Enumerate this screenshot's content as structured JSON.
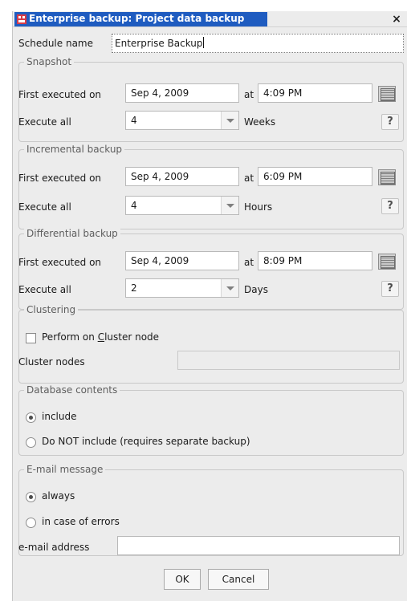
{
  "window": {
    "title": "Enterprise backup: Project data backup",
    "close_label": "×"
  },
  "schedule": {
    "label": "Schedule name",
    "value": "Enterprise Backup"
  },
  "snapshot": {
    "legend": "Snapshot",
    "first_label": "First executed on",
    "date": "Sep 4, 2009",
    "at_label": "at",
    "time": "4:09 PM",
    "execute_label": "Execute all",
    "interval": "4",
    "unit": "Weeks",
    "help_label": "?"
  },
  "incremental": {
    "legend": "Incremental backup",
    "first_label": "First executed on",
    "date": "Sep 4, 2009",
    "at_label": "at",
    "time": "6:09 PM",
    "execute_label": "Execute all",
    "interval": "4",
    "unit": "Hours",
    "help_label": "?"
  },
  "differential": {
    "legend": "Differential backup",
    "first_label": "First executed on",
    "date": "Sep 4, 2009",
    "at_label": "at",
    "time": "8:09 PM",
    "execute_label": "Execute all",
    "interval": "2",
    "unit": "Days",
    "help_label": "?"
  },
  "clustering": {
    "legend": "Clustering",
    "perform_prefix": "Perform on ",
    "perform_mnemonic": "C",
    "perform_suffix": "luster node",
    "nodes_label": "Cluster nodes"
  },
  "database": {
    "legend": "Database contents",
    "include_label": "include",
    "exclude_label": "Do NOT include (requires separate backup)"
  },
  "email": {
    "legend": "E-mail message",
    "always_label": "always",
    "errors_label": "in case of errors",
    "address_label": "e-mail address",
    "address_value": ""
  },
  "buttons": {
    "ok": "OK",
    "cancel": "Cancel"
  },
  "colors": {
    "titlebar_accent": "#1f5cc0",
    "dialog_background": "#ececec"
  }
}
